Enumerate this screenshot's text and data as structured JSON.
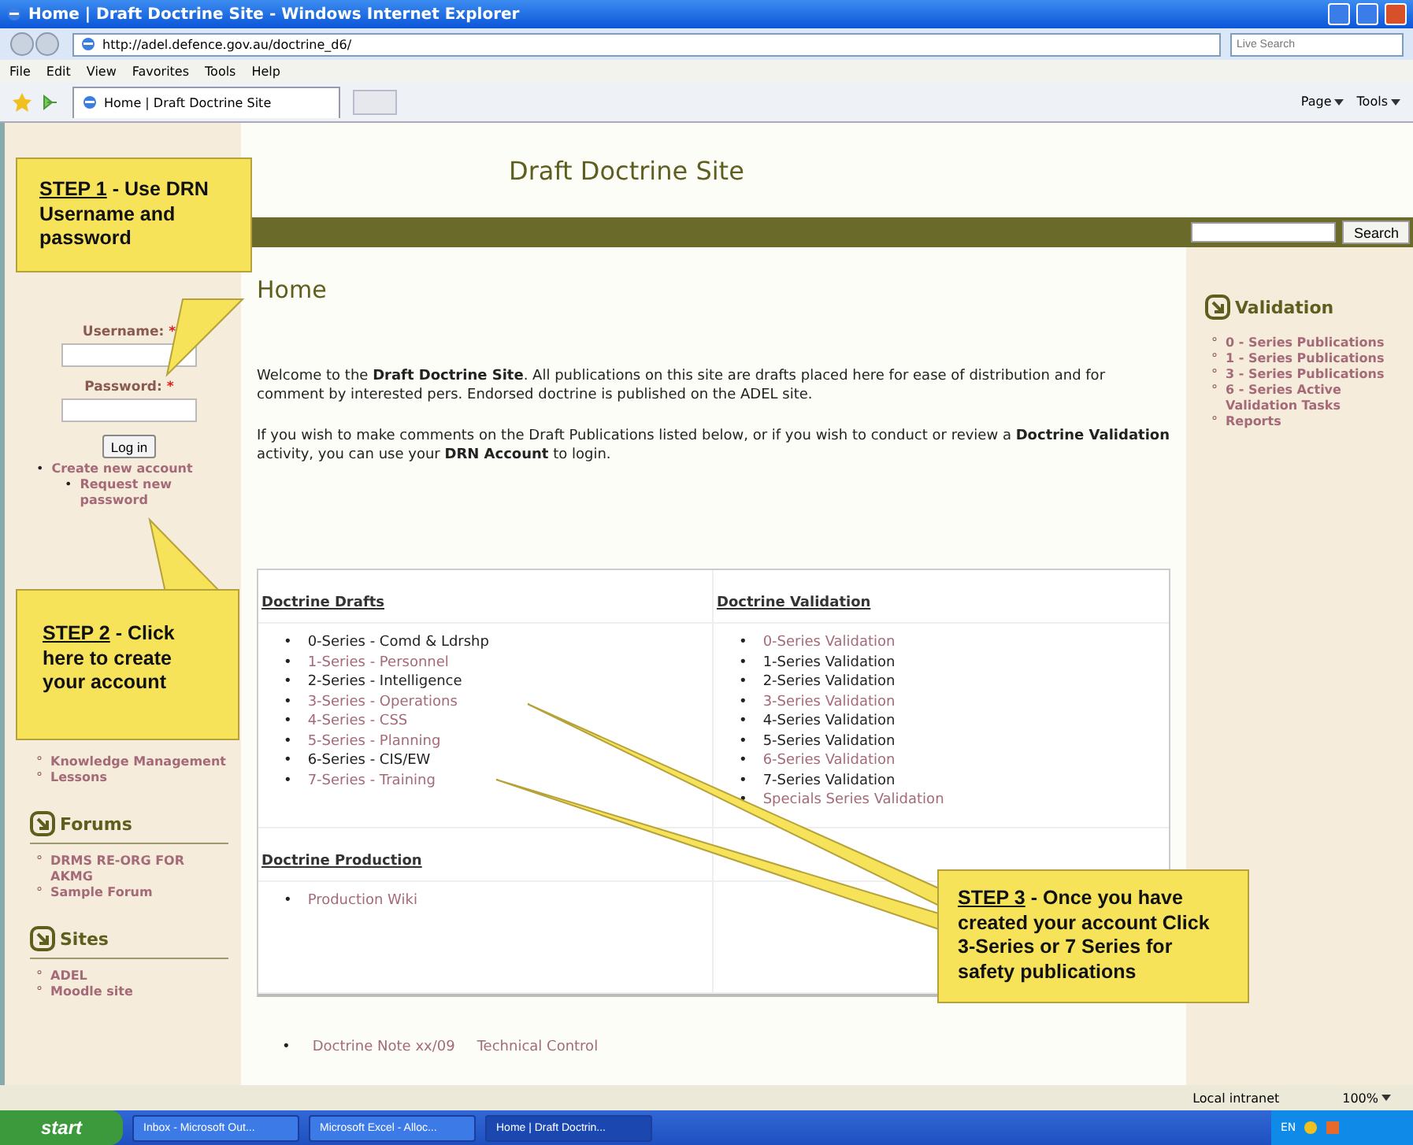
{
  "window": {
    "title": "Home | Draft Doctrine Site - Windows Internet Explorer"
  },
  "address_bar": {
    "url": "http://adel.defence.gov.au/doctrine_d6/",
    "search_placeholder": "Live Search"
  },
  "menu": [
    "File",
    "Edit",
    "View",
    "Favorites",
    "Tools",
    "Help"
  ],
  "tabs": [
    {
      "label": "Home | Draft Doctrine Site",
      "selected": true
    }
  ],
  "toolbar": [
    "Page",
    "Tools"
  ],
  "site": {
    "title": "Draft Doctrine Site",
    "search_button": "Search"
  },
  "login": {
    "username_label": "Username:",
    "password_label": "Password:",
    "required_mark": "*",
    "button": "Log in",
    "marker": "•",
    "links": [
      {
        "label": "Create new account",
        "children": [
          {
            "label": "Request new password"
          }
        ]
      }
    ]
  },
  "left_blocks": [
    {
      "marker": "°",
      "items": [
        "Knowledge Management",
        "Lessons"
      ]
    },
    {
      "heading": "Forums",
      "marker": "°",
      "items": [
        "DRMS RE-ORG FOR AKMG",
        "Sample Forum"
      ]
    },
    {
      "heading": "Sites",
      "marker": "°",
      "items": [
        "ADEL",
        "Moodle site"
      ]
    }
  ],
  "page_title": "Home",
  "intro": [
    "Welcome to the **Draft Doctrine Site**.  All publications on this site are drafts placed here for ease of distribution and for comment by interested pers.  Endorsed doctrine is published on the ADEL site.",
    "If you wish to make comments on the Draft Publications listed below, or if you wish to conduct or review a **Doctrine Validation** activity, you can use your **DRN Account** to login."
  ],
  "table": {
    "sections": [
      {
        "headings": [
          "Doctrine Drafts",
          "Doctrine Validation"
        ],
        "columns": [
          {
            "marker": "•",
            "items": [
              {
                "label": "0-Series - Comd & Ldrshp",
                "link": false
              },
              {
                "label": "1-Series - Personnel",
                "link": true
              },
              {
                "label": "2-Series - Intelligence",
                "link": false
              },
              {
                "label": "3-Series - Operations",
                "link": true
              },
              {
                "label": "4-Series - CSS",
                "link": true
              },
              {
                "label": "5-Series - Planning",
                "link": true
              },
              {
                "label": "6-Series - CIS/EW",
                "link": false
              },
              {
                "label": "7-Series - Training",
                "link": true
              }
            ]
          },
          {
            "marker": "•",
            "items": [
              {
                "label": "0-Series Validation",
                "link": true
              },
              {
                "label": "1-Series Validation",
                "link": false
              },
              {
                "label": "2-Series Validation",
                "link": false
              },
              {
                "label": "3-Series Validation",
                "link": true
              },
              {
                "label": "4-Series Validation",
                "link": false
              },
              {
                "label": "5-Series Validation",
                "link": false
              },
              {
                "label": "6-Series Validation",
                "link": true
              },
              {
                "label": "7-Series Validation",
                "link": false
              },
              {
                "label": "Specials Series Validation",
                "link": true
              }
            ]
          }
        ]
      },
      {
        "headings": [
          "Doctrine Production"
        ],
        "columns": [
          {
            "marker": "•",
            "items": [
              {
                "label": "Production Wiki",
                "link": true
              }
            ]
          }
        ]
      }
    ]
  },
  "footer": {
    "marker": "•",
    "links": [
      "Doctrine Note xx/09",
      "Technical Control"
    ]
  },
  "right_block": {
    "heading": "Validation",
    "marker": "°",
    "items": [
      "0 - Series Publications",
      "1 - Series Publications",
      "3 - Series Publications",
      "6 - Series Active Validation Tasks",
      "Reports"
    ]
  },
  "callouts": [
    {
      "step": "STEP 1",
      "text": " - Use DRN Username and password"
    },
    {
      "step": "STEP 2",
      "text": " - Click here to create your account"
    },
    {
      "step": "STEP 3",
      "text": " - Once you have created your account Click 3-Series or 7 Series for safety publications"
    }
  ],
  "status_bar": {
    "zone": "Local intranet",
    "zoom": "100%"
  },
  "taskbar": {
    "start": "start",
    "tasks": [
      {
        "label": "Inbox - Microsoft Out...",
        "selected": false
      },
      {
        "label": "Microsoft Excel - Alloc...",
        "selected": false
      },
      {
        "label": "Home | Draft Doctrin...",
        "selected": true
      }
    ],
    "language": "EN"
  }
}
